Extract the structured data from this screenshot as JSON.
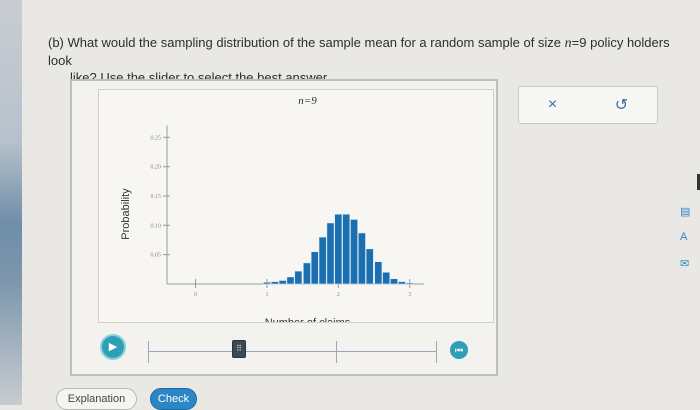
{
  "question": {
    "part": "(b)",
    "line1_pre": "What would the sampling distribution of the sample mean for a random sample of size ",
    "n_var": "n",
    "line1_eq": "=9",
    "line1_post": " policy holders look",
    "line2": "like? Use the slider to select the best answer."
  },
  "chart_data": {
    "type": "bar",
    "title": "n=9",
    "xlabel": "Number of claims",
    "ylabel": "Probability",
    "yticks": [
      "0.05",
      "0.10",
      "0.15",
      "0.20",
      "0.25"
    ],
    "xticks": [
      "0",
      "1",
      "2",
      "3"
    ],
    "xlim": [
      -0.4,
      3.2
    ],
    "ylim": [
      0,
      0.3
    ],
    "bars": [
      {
        "x": 1.0,
        "y": 0.003
      },
      {
        "x": 1.11,
        "y": 0.004
      },
      {
        "x": 1.22,
        "y": 0.006
      },
      {
        "x": 1.33,
        "y": 0.012
      },
      {
        "x": 1.44,
        "y": 0.022
      },
      {
        "x": 1.56,
        "y": 0.036
      },
      {
        "x": 1.67,
        "y": 0.055
      },
      {
        "x": 1.78,
        "y": 0.08
      },
      {
        "x": 1.89,
        "y": 0.104
      },
      {
        "x": 2.0,
        "y": 0.119
      },
      {
        "x": 2.11,
        "y": 0.119
      },
      {
        "x": 2.22,
        "y": 0.11
      },
      {
        "x": 2.33,
        "y": 0.087
      },
      {
        "x": 2.44,
        "y": 0.06
      },
      {
        "x": 2.56,
        "y": 0.038
      },
      {
        "x": 2.67,
        "y": 0.02
      },
      {
        "x": 2.78,
        "y": 0.009
      },
      {
        "x": 2.89,
        "y": 0.004
      },
      {
        "x": 3.0,
        "y": 0.002
      }
    ],
    "bar_color": "#1a6fb0",
    "grid": false
  },
  "toolbar": {
    "close_icon": "×",
    "reset_icon": "↺"
  },
  "slider": {
    "play_icon": "▶",
    "handle_glyph": "⠿",
    "reset_icon": "⏮"
  },
  "buttons": {
    "explanation": "Explanation",
    "check": "Check"
  },
  "colors": {
    "accent": "#2d86c4",
    "teal": "#2e9fb7",
    "bar": "#1a6fb0"
  }
}
